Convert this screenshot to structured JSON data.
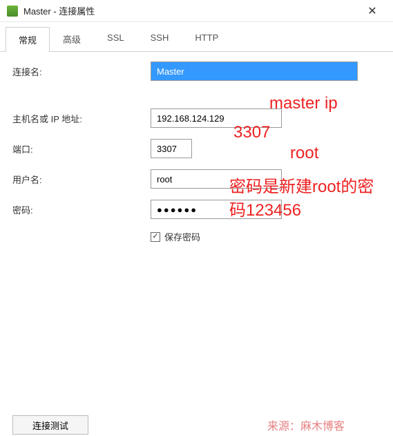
{
  "titlebar": {
    "title": "Master - 连接属性"
  },
  "tabs": {
    "general": "常规",
    "advanced": "高级",
    "ssl": "SSL",
    "ssh": "SSH",
    "http": "HTTP"
  },
  "labels": {
    "conn_name": "连接名:",
    "host": "主机名或 IP 地址:",
    "port": "端口:",
    "user": "用户名:",
    "password": "密码:",
    "save_pw": "保存密码"
  },
  "values": {
    "conn_name": "Master",
    "host": "192.168.124.129",
    "port": "3307",
    "user": "root",
    "password_mask": "●●●●●●",
    "save_pw_checked": "✓"
  },
  "annotations": {
    "host": "master ip",
    "port": "3307",
    "user": "root",
    "password": "密码是新建root的密码123456"
  },
  "footer": {
    "test": "连接测试",
    "source": "来源：麻木博客"
  }
}
